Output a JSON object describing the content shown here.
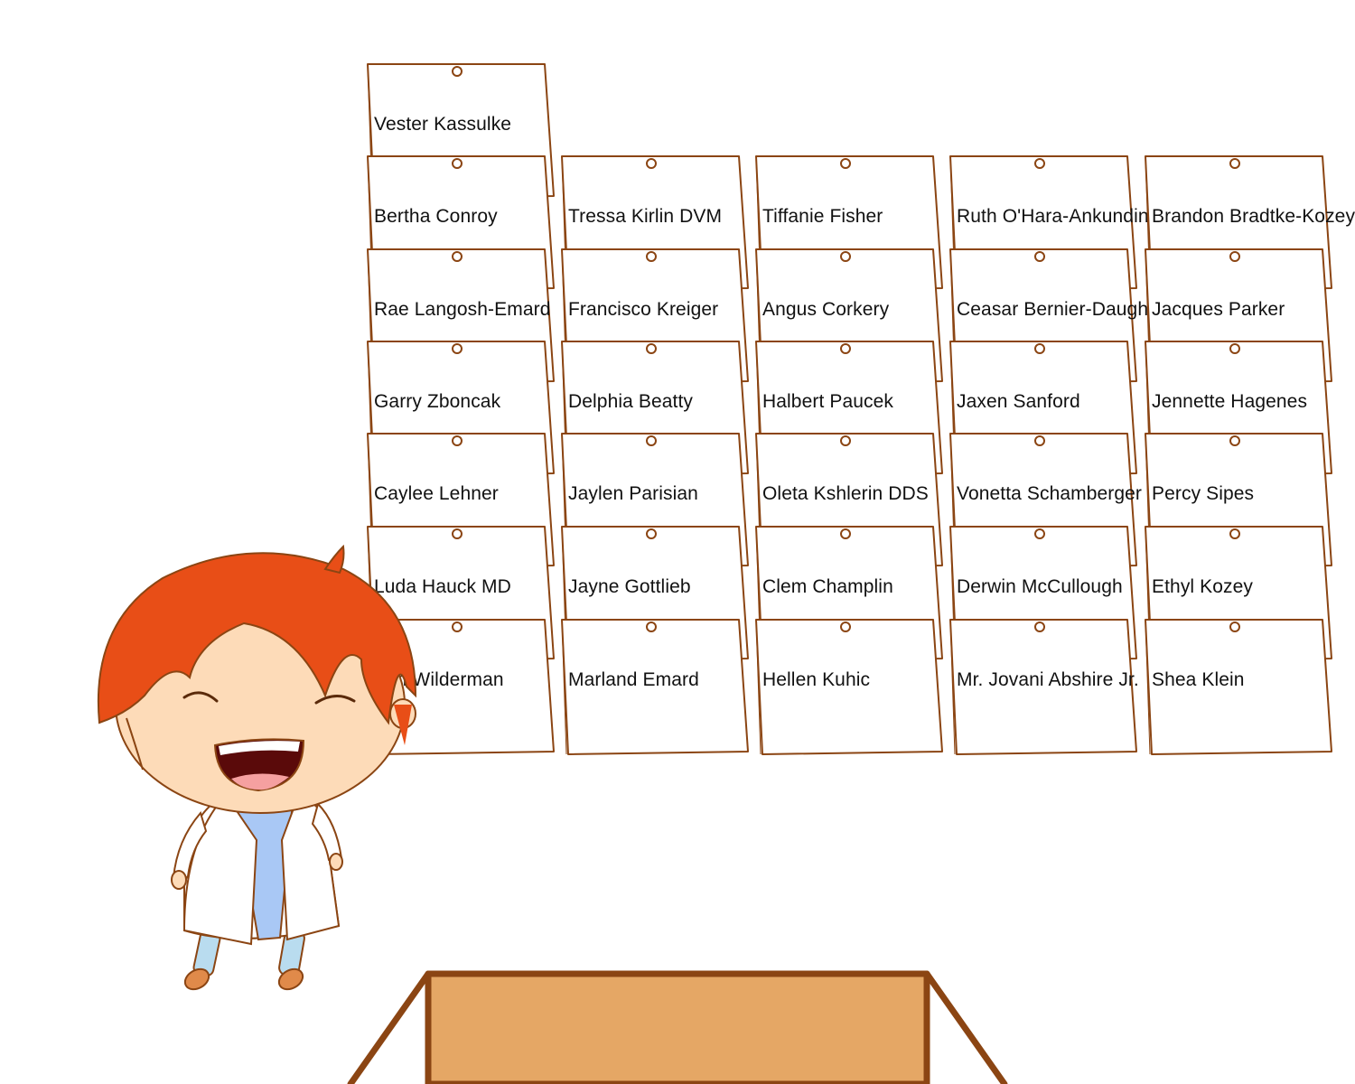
{
  "cards": [
    {
      "name": "Vester Kassulke",
      "col": 0,
      "row": 0
    },
    {
      "name": "Bertha Conroy",
      "col": 0,
      "row": 1
    },
    {
      "name": "Rae Langosh-Emard",
      "col": 0,
      "row": 2
    },
    {
      "name": "Garry Zboncak",
      "col": 0,
      "row": 3
    },
    {
      "name": "Caylee Lehner",
      "col": 0,
      "row": 4
    },
    {
      "name": "Luda Hauck MD",
      "col": 0,
      "row": 5
    },
    {
      "name": "Kim Wilderman",
      "col": 0,
      "row": 6
    },
    {
      "name": "Tressa Kirlin DVM",
      "col": 1,
      "row": 1
    },
    {
      "name": "Francisco Kreiger",
      "col": 1,
      "row": 2
    },
    {
      "name": "Delphia Beatty",
      "col": 1,
      "row": 3
    },
    {
      "name": "Jaylen Parisian",
      "col": 1,
      "row": 4
    },
    {
      "name": "Jayne Gottlieb",
      "col": 1,
      "row": 5
    },
    {
      "name": "Marland Emard",
      "col": 1,
      "row": 6
    },
    {
      "name": "Tiffanie Fisher",
      "col": 2,
      "row": 1
    },
    {
      "name": "Angus Corkery",
      "col": 2,
      "row": 2
    },
    {
      "name": "Halbert Paucek",
      "col": 2,
      "row": 3
    },
    {
      "name": "Oleta Kshlerin DDS",
      "col": 2,
      "row": 4
    },
    {
      "name": "Clem Champlin",
      "col": 2,
      "row": 5
    },
    {
      "name": "Hellen Kuhic",
      "col": 2,
      "row": 6
    },
    {
      "name": "Ruth O'Hara-Ankunding",
      "col": 3,
      "row": 1
    },
    {
      "name": "Ceasar Bernier-Daugherty",
      "col": 3,
      "row": 2
    },
    {
      "name": "Jaxen Sanford",
      "col": 3,
      "row": 3
    },
    {
      "name": "Vonetta Schamberger",
      "col": 3,
      "row": 4
    },
    {
      "name": "Derwin McCullough",
      "col": 3,
      "row": 5
    },
    {
      "name": "Mr. Jovani Abshire Jr.",
      "col": 3,
      "row": 6
    },
    {
      "name": "Brandon Bradtke-Kozey",
      "col": 4,
      "row": 1
    },
    {
      "name": "Jacques Parker",
      "col": 4,
      "row": 2
    },
    {
      "name": "Jennette Hagenes",
      "col": 4,
      "row": 3
    },
    {
      "name": "Percy Sipes",
      "col": 4,
      "row": 4
    },
    {
      "name": "Ethyl Kozey",
      "col": 4,
      "row": 5
    },
    {
      "name": "Shea Klein",
      "col": 4,
      "row": 6
    }
  ],
  "colors": {
    "card_border": "#8b4513",
    "box_fill": "#e5a765",
    "box_outline": "#8b4513",
    "hair": "#e84e17",
    "skin": "#fddbb8",
    "coat": "#ffffff",
    "shirt": "#a9c8f5"
  }
}
